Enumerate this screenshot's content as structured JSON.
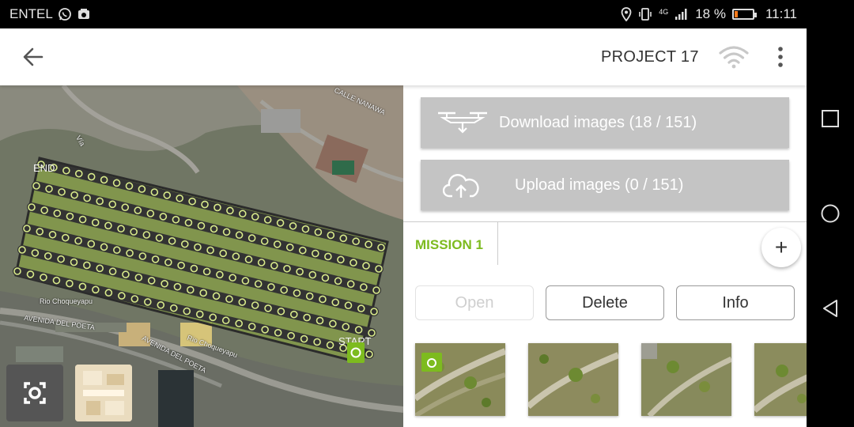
{
  "status_bar": {
    "carrier": "ENTEL",
    "network_label": "4G",
    "battery_text": "18 %",
    "battery_level": 0.18,
    "battery_color": "#ff7a1a",
    "time": "11:11",
    "icons": [
      "whatsapp-icon",
      "notification-icon",
      "location-icon",
      "vibrate-icon",
      "signal-icon",
      "battery-icon"
    ]
  },
  "app_bar": {
    "title": "PROJECT 17",
    "icons": [
      "back-arrow-icon",
      "wifi-icon",
      "more-vert-icon"
    ]
  },
  "map": {
    "end_label": "END",
    "start_label": "START",
    "road_labels": [
      "CALLE NANAWA",
      "Rio Choqueyapu",
      "AVENIDA DEL POETA",
      "AVENIDA DEL POETA",
      "Rio Choqueyapu",
      "Vía"
    ],
    "icons": [
      "locate-icon",
      "layers-icon"
    ]
  },
  "actions": {
    "download_label": "Download images (18 / 151)",
    "upload_label": "Upload images (0 / 151)",
    "button_color": "#c4c4c4",
    "icons": [
      "drone-icon",
      "cloud-upload-icon"
    ]
  },
  "mission": {
    "tab_label": "MISSION 1",
    "accent": "#7dbb1f",
    "add_label": "+",
    "buttons": {
      "open": "Open",
      "delete": "Delete",
      "info": "Info"
    }
  },
  "thumbnails": {
    "count": 4,
    "badge_icon": "camera-icon"
  }
}
